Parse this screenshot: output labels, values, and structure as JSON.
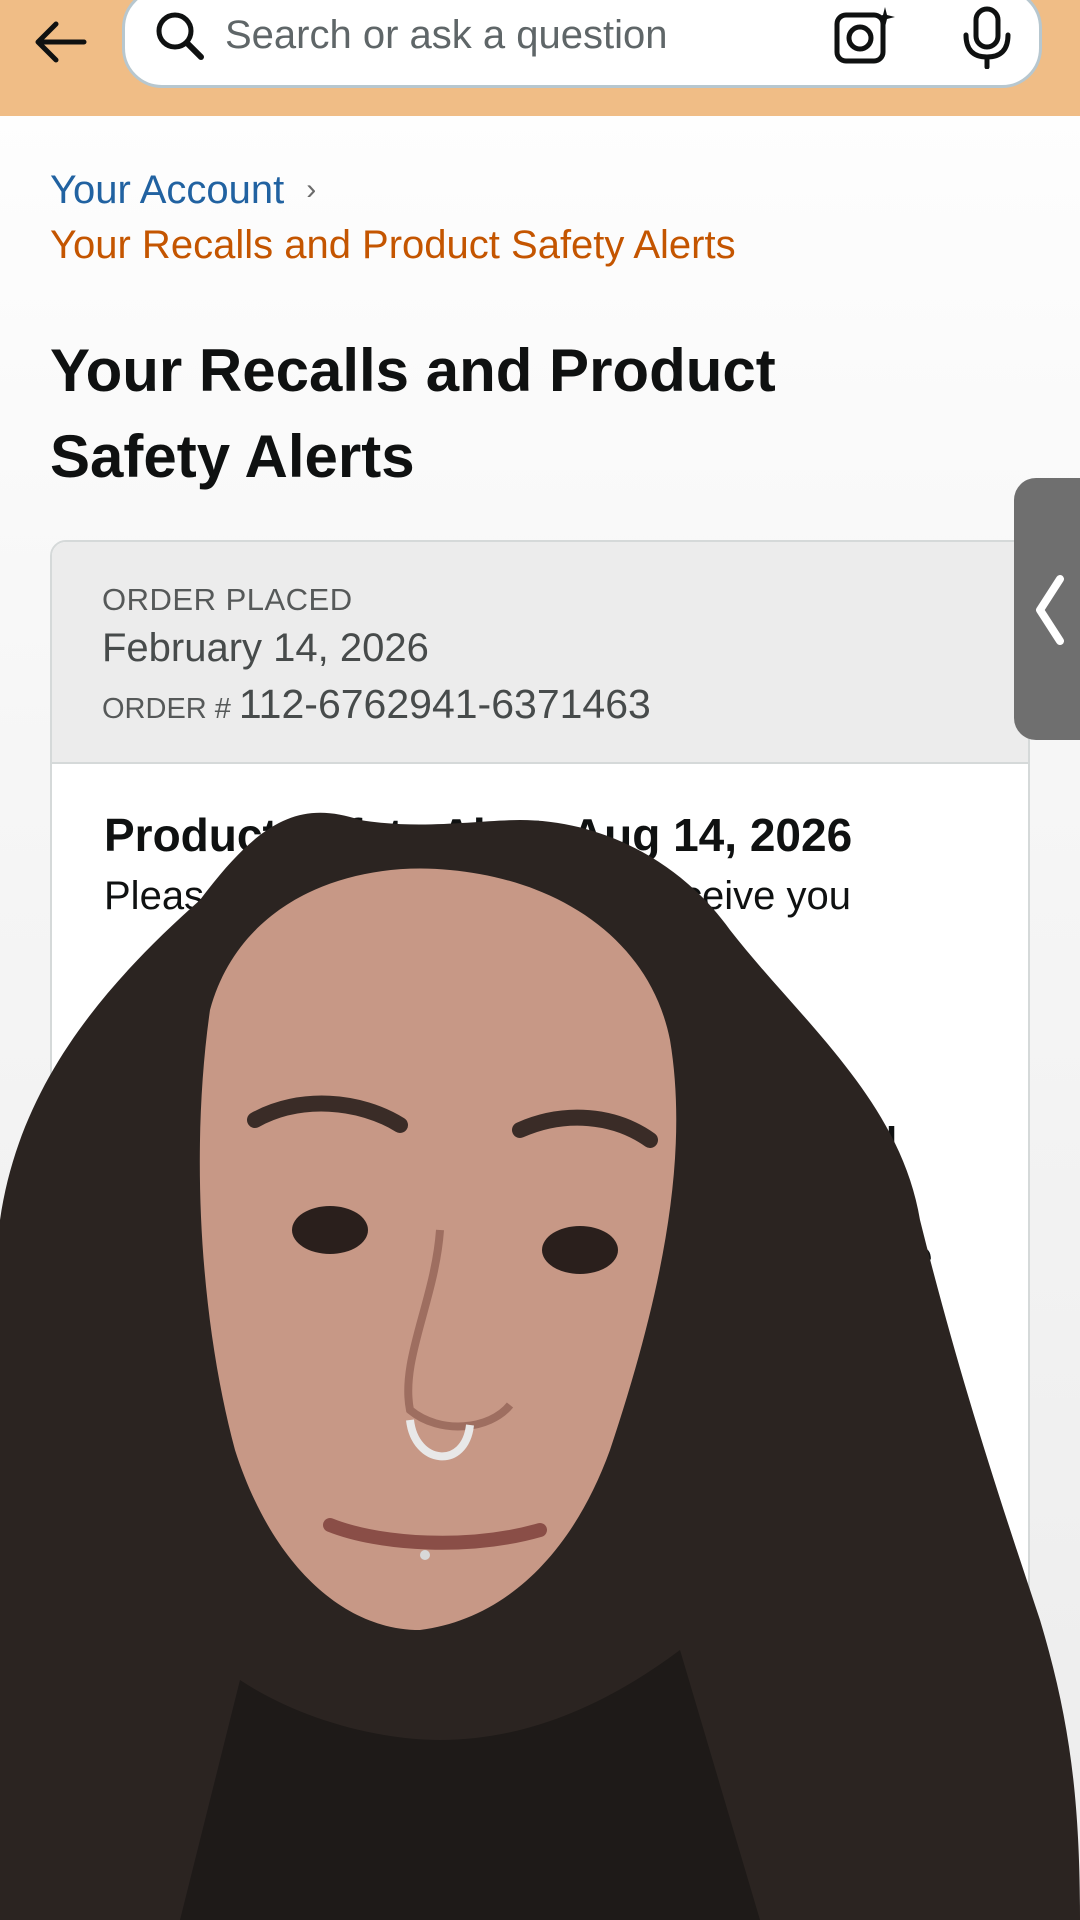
{
  "topbar": {
    "back_icon": "arrow-left-icon",
    "search": {
      "placeholder": "Search or ask a question",
      "search_icon": "search-icon",
      "camera_icon": "camera-lens-icon",
      "mic_icon": "microphone-icon"
    }
  },
  "breadcrumb": {
    "account": "Your Account",
    "separator": "›",
    "current": "Your Recalls and Product Safety Alerts"
  },
  "page": {
    "title": "Your Recalls and Product Safety Alerts"
  },
  "order": {
    "placed_label": "ORDER PLACED",
    "placed_date": "February 14, 2026",
    "order_number_label": "ORDER #",
    "order_number": "112-6762941-6371463",
    "alert_title": "Product Safety Alert: Aug 14, 2026",
    "alert_text": "Please st                    ct. Destroy the ite                         to receive you",
    "visible_fragments": [
      "rid",
      "e",
      "to"
    ]
  },
  "side_panel": {
    "icon": "chevron-left-icon"
  },
  "colors": {
    "topbar": "#f0bd86",
    "link_blue": "#2162a1",
    "link_orange": "#c45500",
    "button_yellow": "#ffd814"
  }
}
